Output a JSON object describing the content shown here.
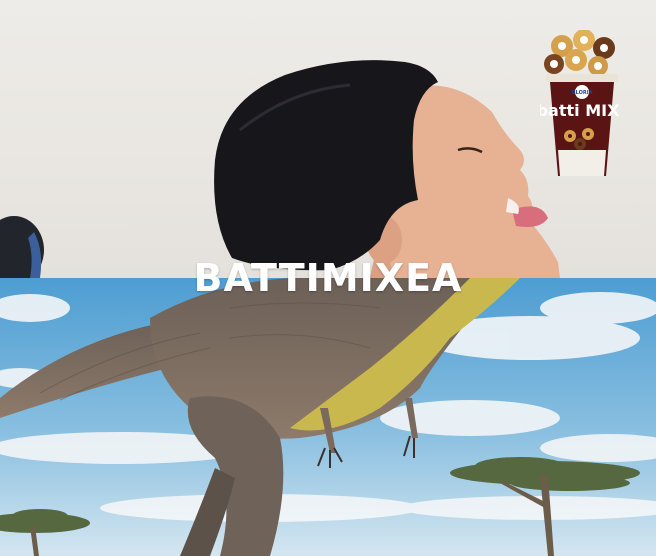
{
  "headline": "BATTIMIXEA",
  "product": {
    "brand": "GLORIA",
    "name": "batti MIX"
  },
  "colors": {
    "sky_top": "#5aa7d6",
    "sky_bottom": "#cfe3ef",
    "wall": "#eceae5",
    "dinosaur": "#7a6a5e",
    "dinosaur_belly": "#c9bb52",
    "hair": "#1a1a1d",
    "skin": "#e6b092",
    "cup_body": "#5a1414"
  }
}
